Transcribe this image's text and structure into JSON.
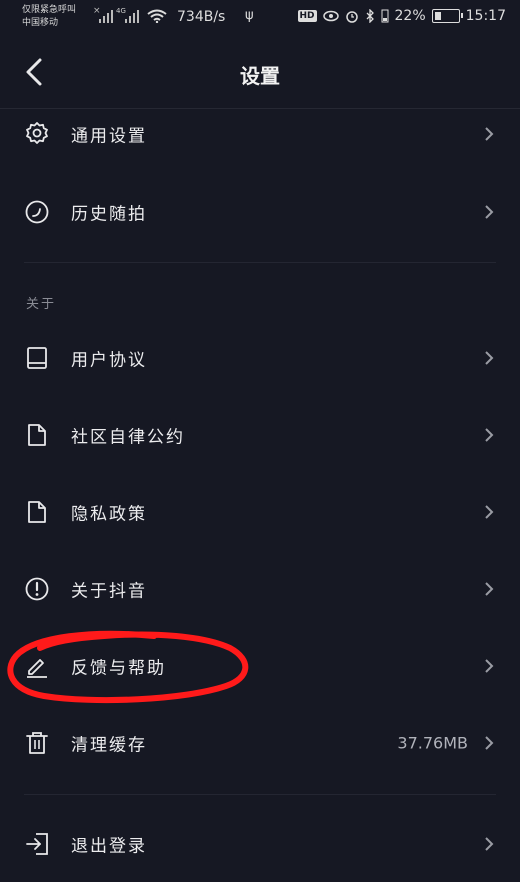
{
  "status_bar": {
    "carrier_line1": "仅限紧急呼叫",
    "carrier_line2": "中国移动",
    "x_mark": "×",
    "network_type": "4G",
    "speed": "734B/s",
    "usb_glyph": "ψ",
    "hd_badge": "HD",
    "battery": "22%",
    "time": "15:17"
  },
  "header": {
    "title": "设置"
  },
  "section_about": "关于",
  "items": {
    "general": {
      "label": "通用设置",
      "icon": "gear-icon"
    },
    "history": {
      "label": "历史随拍",
      "icon": "clock-icon"
    },
    "user_agreement": {
      "label": "用户协议",
      "icon": "book-icon"
    },
    "community": {
      "label": "社区自律公约",
      "icon": "document-icon"
    },
    "privacy": {
      "label": "隐私政策",
      "icon": "document-icon"
    },
    "about": {
      "label": "关于抖音",
      "icon": "info-icon"
    },
    "feedback": {
      "label": "反馈与帮助",
      "icon": "pencil-icon"
    },
    "cache": {
      "label": "清理缓存",
      "icon": "trash-icon",
      "value": "37.76MB"
    },
    "logout": {
      "label": "退出登录",
      "icon": "logout-icon"
    }
  },
  "colors": {
    "background": "#161823",
    "text": "#ececee",
    "secondary_text": "#8a8c95",
    "annotation": "#ff1a1a"
  }
}
